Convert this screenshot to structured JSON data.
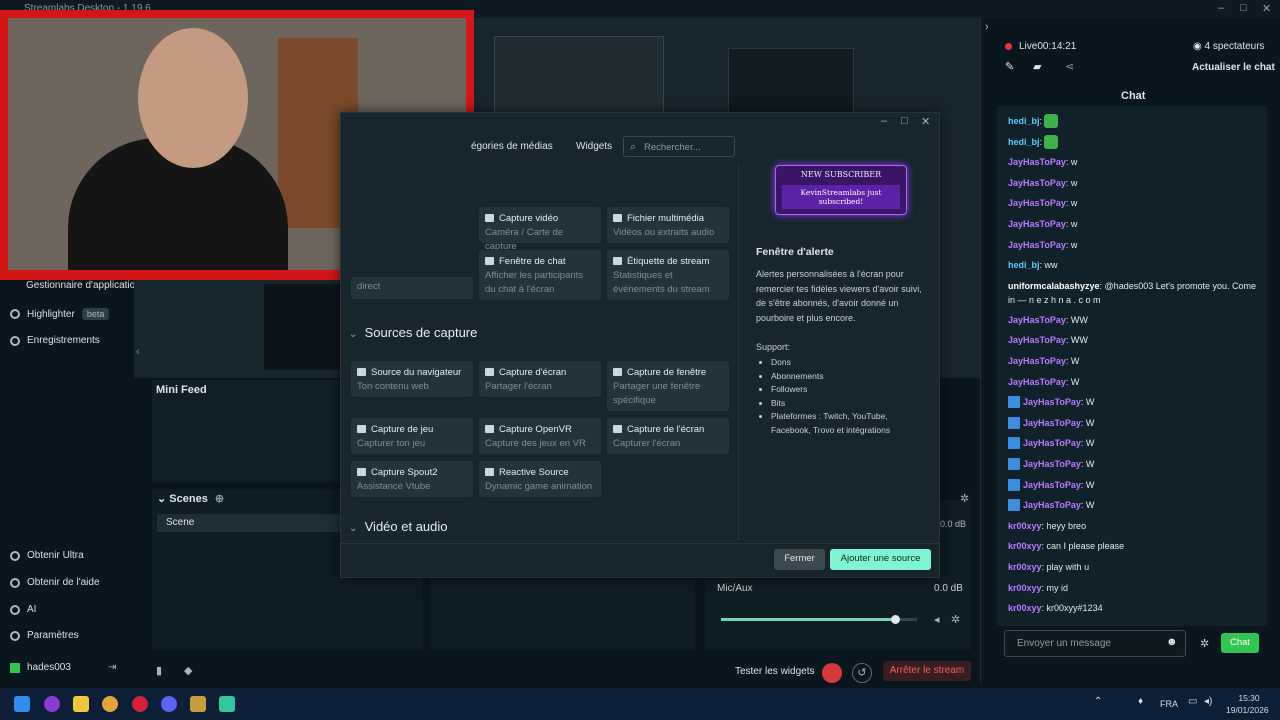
{
  "app": {
    "title": "Streamlabs Desktop - 1.19.6"
  },
  "nav": {
    "app_store": "Gestionnaire d'applications",
    "highlighter": "Highlighter",
    "highlighter_badge": "beta",
    "recordings": "Enregistrements",
    "ultra": "Obtenir Ultra",
    "help": "Obtenir de l'aide",
    "ai": "AI",
    "settings": "Paramètres",
    "user": "hades003"
  },
  "panels": {
    "mini_feed": "Mini Feed",
    "scenes": "Scenes",
    "scene_item": "Scene"
  },
  "mixer": {
    "desktop_db": "0.0 dB",
    "mic_label": "Mic/Aux",
    "mic_db": "0.0 dB",
    "mic_level": 0.89
  },
  "bottom": {
    "test_widgets": "Tester les widgets",
    "stop_stream": "Arrêter le stream"
  },
  "live": {
    "status": "Live",
    "time": "00:14:21",
    "viewers": "4 spectateurs",
    "refresh_chat": "Actualiser le chat",
    "chat_tab": "Chat"
  },
  "chat": {
    "messages": [
      {
        "user": "hedi_bj",
        "text": "",
        "emote": true,
        "color": "#5ec8ff"
      },
      {
        "user": "hedi_bj",
        "text": "",
        "emote": true,
        "color": "#5ec8ff"
      },
      {
        "user": "JayHasToPay",
        "text": ": w",
        "color": "#b67cff"
      },
      {
        "user": "JayHasToPay",
        "text": ": w",
        "color": "#b67cff"
      },
      {
        "user": "JayHasToPay",
        "text": ": w",
        "color": "#b67cff"
      },
      {
        "user": "JayHasToPay",
        "text": ": w",
        "color": "#b67cff"
      },
      {
        "user": "JayHasToPay",
        "text": ": w",
        "color": "#b67cff"
      },
      {
        "user": "hedi_bj",
        "text": ": ww",
        "color": "#5ec8ff"
      },
      {
        "user": "uniformcalabashyzye",
        "text": ": @hades003 Let's promote you. Come in — n e z h n a . c o m",
        "color": "#ffffff"
      },
      {
        "user": "JayHasToPay",
        "text": ": WW",
        "color": "#b67cff"
      },
      {
        "user": "JayHasToPay",
        "text": ": WW",
        "color": "#b67cff"
      },
      {
        "user": "JayHasToPay",
        "text": ": W",
        "color": "#b67cff"
      },
      {
        "user": "JayHasToPay",
        "text": ": W",
        "color": "#b67cff"
      },
      {
        "user": "JayHasToPay",
        "text": ": W",
        "color": "#b67cff",
        "icon": true
      },
      {
        "user": "JayHasToPay",
        "text": ": W",
        "color": "#b67cff",
        "icon": true
      },
      {
        "user": "JayHasToPay",
        "text": ": W",
        "color": "#b67cff",
        "icon": true
      },
      {
        "user": "JayHasToPay",
        "text": ": W",
        "color": "#b67cff",
        "icon": true
      },
      {
        "user": "JayHasToPay",
        "text": ": W",
        "color": "#b67cff",
        "icon": true
      },
      {
        "user": "JayHasToPay",
        "text": ": W",
        "color": "#b67cff",
        "icon": true
      },
      {
        "user": "kr00xyy",
        "text": ": heyy breo",
        "color": "#b67cff"
      },
      {
        "user": "kr00xyy",
        "text": ": can I please please",
        "color": "#b67cff"
      },
      {
        "user": "kr00xyy",
        "text": ": play with u",
        "color": "#b67cff"
      },
      {
        "user": "kr00xyy",
        "text": ": my id",
        "color": "#b67cff"
      },
      {
        "user": "kr00xyy",
        "text": ": kr00xyy#1234",
        "color": "#b67cff"
      }
    ],
    "input_placeholder": "Envoyer un message",
    "send_label": "Chat"
  },
  "modal": {
    "tabs": [
      "égories de médias",
      "Widgets"
    ],
    "search_placeholder": "Rechercher...",
    "top_cards": [
      {
        "title": "Capture vidéo",
        "desc": "Caméra / Carte de capture"
      },
      {
        "title": "Fichier multimédia",
        "desc": "Vidéos ou extraits audio"
      },
      {
        "title": "Fenêtre de chat",
        "desc": "Afficher les participants du chat à l'écran"
      },
      {
        "title": "Étiquette de stream",
        "desc": "Statistiques et événements du stream"
      }
    ],
    "partial_card_desc": "direct",
    "section_capture": "Sources de capture",
    "capture_cards": [
      {
        "title": "Source du navigateur",
        "desc": "Ton contenu web"
      },
      {
        "title": "Capture d'écran",
        "desc": "Partager l'écran"
      },
      {
        "title": "Capture de fenêtre",
        "desc": "Partager une fenêtre spécifique"
      },
      {
        "title": "Capture de jeu",
        "desc": "Capturer ton jeu"
      },
      {
        "title": "Capture OpenVR",
        "desc": "Capture des jeux en VR"
      },
      {
        "title": "Capture de l'écran",
        "desc": "Capturer l'écran"
      },
      {
        "title": "Capture Spout2",
        "desc": "Assistance Vtube"
      },
      {
        "title": "Reactive Source",
        "desc": "Dynamic game animation"
      }
    ],
    "section_video": "Vidéo et audio",
    "preview": {
      "banner_top": "NEW SUBSCRIBER",
      "banner_text": "KevinStreamlabs just subscribed!",
      "title": "Fenêtre d'alerte",
      "desc": "Alertes personnalisées à l'écran pour remercier tes fidèles viewers d'avoir suivi, de s'être abonnés, d'avoir donné un pourboire et plus encore.",
      "support_label": "Support:",
      "support_items": [
        "Dons",
        "Abonnements",
        "Followers",
        "Bits",
        "Plateformes : Twitch, YouTube, Facebook, Trovo et intégrations"
      ]
    },
    "close_label": "Fermer",
    "add_label": "Ajouter une source"
  },
  "taskbar": {
    "lang": "FRA",
    "time": "15:30",
    "date": "19/01/2026"
  }
}
